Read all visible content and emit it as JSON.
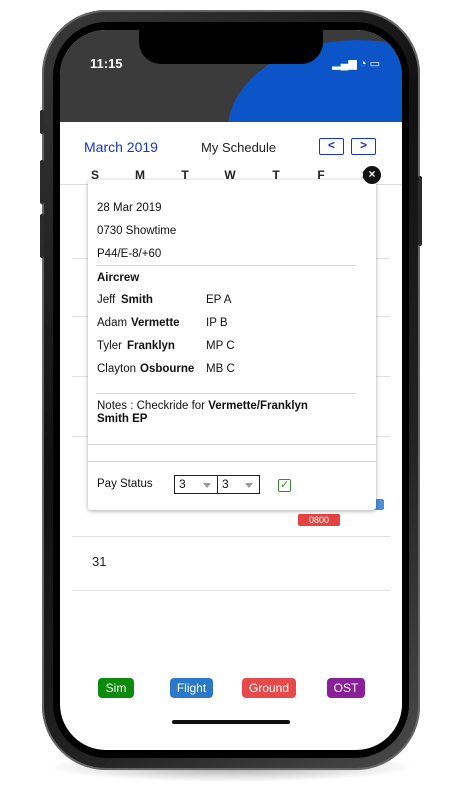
{
  "status_bar": {
    "time": "11:15",
    "icons": "▂▄▆ ◔ ▭"
  },
  "header": {
    "month": "March 2019",
    "title": "My Schedule",
    "prev_icon": "<",
    "next_icon": ">"
  },
  "weekdays": [
    "S",
    "M",
    "T",
    "W",
    "T",
    "F",
    "S"
  ],
  "calendar": {
    "date_31": "31",
    "badge_time": "0800"
  },
  "popup": {
    "close_icon": "×",
    "date": "28 Mar 2019",
    "showtime": "0730 Showtime",
    "code": "P44/E-8/+60",
    "aircrew_title": "Aircrew",
    "crew": [
      {
        "first": "Jeff",
        "last": "Smith",
        "role": "EP A"
      },
      {
        "first": "Adam",
        "last": "Vermette",
        "role": "IP B"
      },
      {
        "first": "Tyler",
        "last": "Franklyn",
        "role": "MP C"
      },
      {
        "first": "Clayton",
        "last": "Osbourne",
        "role": "MB C"
      }
    ],
    "notes_prefix": "Notes : Checkride for",
    "notes_names": "Vermette/Franklyn",
    "notes_line2": "Smith EP",
    "pay_status_label": "Pay Status",
    "pay_select_1": "3",
    "pay_select_2": "3",
    "check_icon": "✓"
  },
  "legend": [
    {
      "label": "Sim",
      "color": "#0b8a0b"
    },
    {
      "label": "Flight",
      "color": "#2a78c9"
    },
    {
      "label": "Ground",
      "color": "#e74a4a"
    },
    {
      "label": "OST",
      "color": "#8a1f9a"
    }
  ]
}
